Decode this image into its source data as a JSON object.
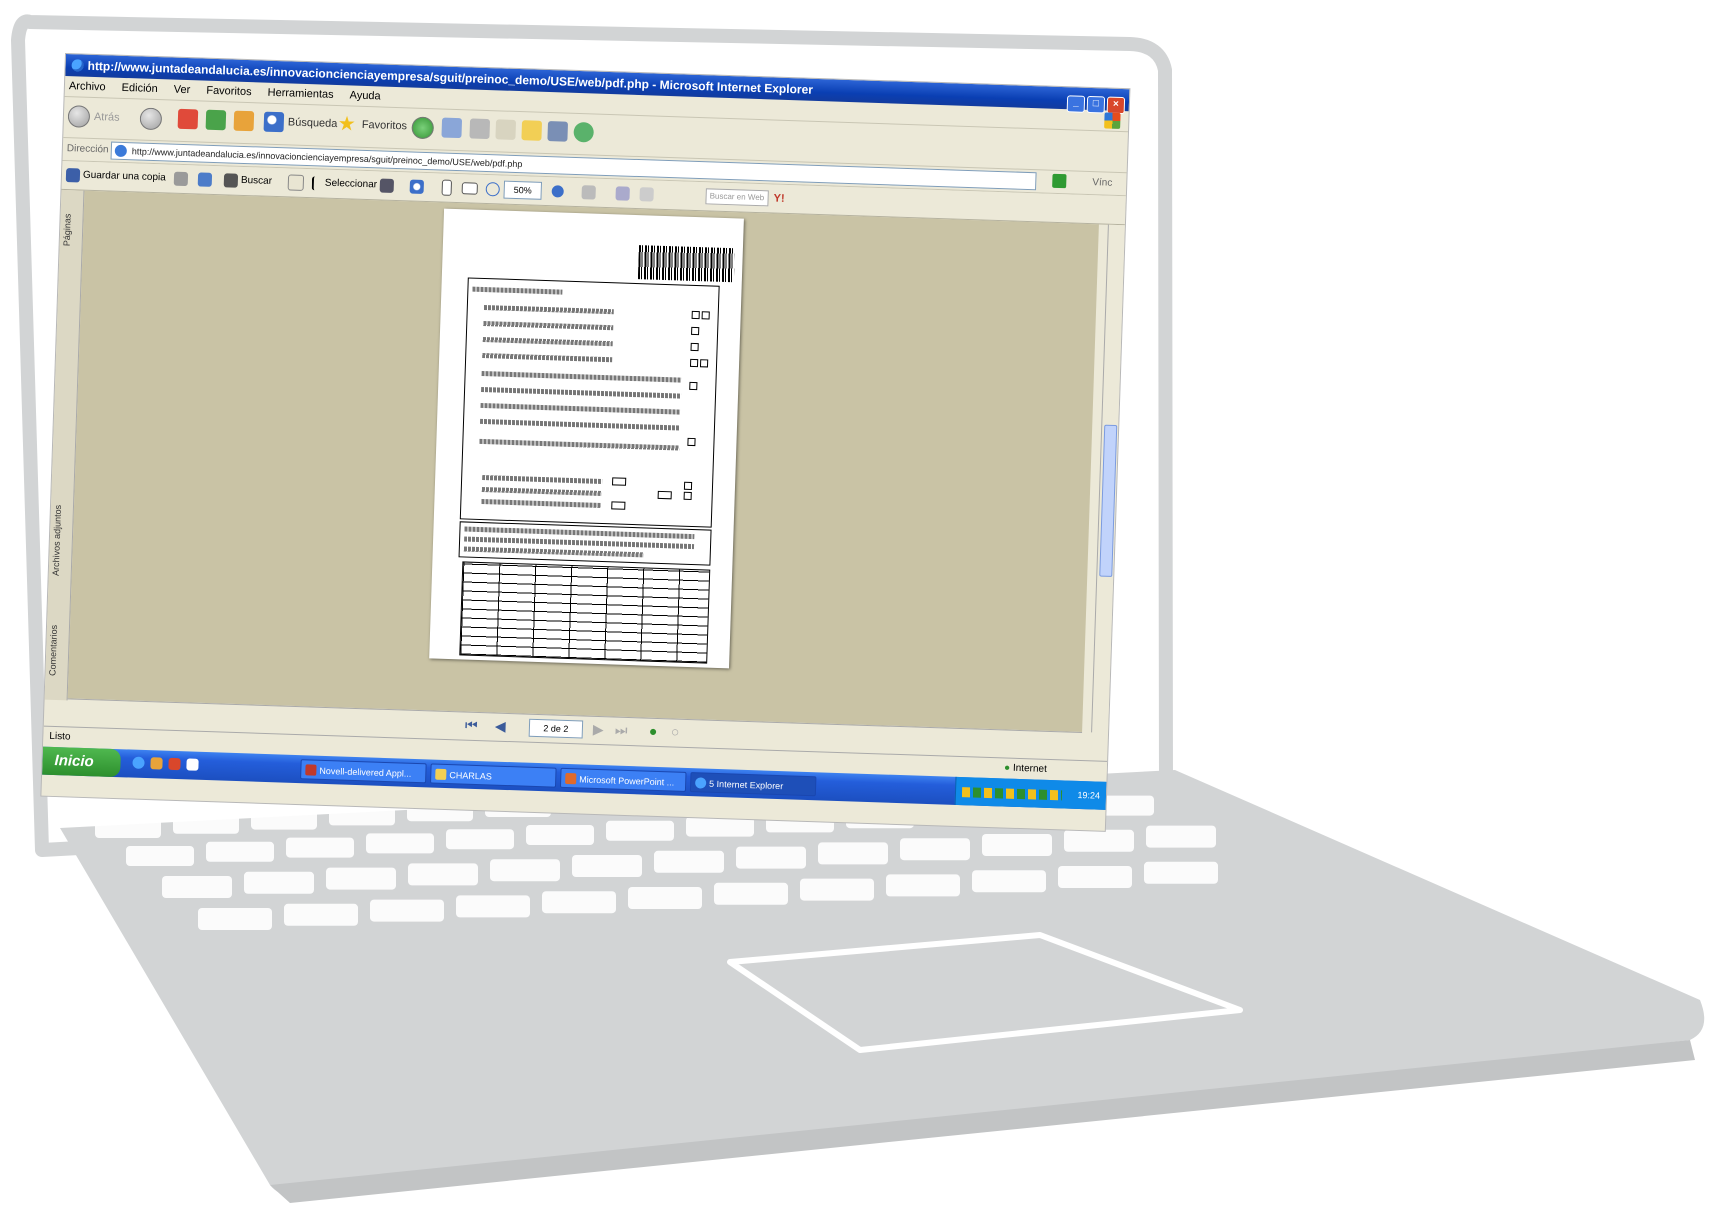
{
  "browser": {
    "title": "http://www.juntadeandalucia.es/innovacioncienciayempresa/sguit/preinoc_demo/USE/web/pdf.php - Microsoft Internet Explorer",
    "menu": [
      "Archivo",
      "Edición",
      "Ver",
      "Favoritos",
      "Herramientas",
      "Ayuda"
    ],
    "toolbar": {
      "back": "Atrás",
      "search": "Búsqueda",
      "favorites": "Favoritos"
    },
    "address_label": "Dirección",
    "address": "http://www.juntadeandalucia.es/innovacioncienciayempresa/sguit/preinoc_demo/USE/web/pdf.php",
    "links": "Vínc"
  },
  "pdf_toolbar": {
    "save": "Guardar una copia",
    "find": "Buscar",
    "select": "Seleccionar",
    "zoom": "50%",
    "search_web_placeholder": "Buscar en Web"
  },
  "side_tabs": [
    "Páginas",
    "Archivos adjuntos",
    "Comentarios"
  ],
  "pagination": {
    "page": "2 de 2"
  },
  "status": {
    "left": "Listo",
    "zone": "Internet"
  },
  "taskbar": {
    "start": "Inicio",
    "tasks": [
      "Novell-delivered Appl...",
      "CHARLAS",
      "Microsoft PowerPoint ...",
      "5 Internet Explorer"
    ],
    "time": "19:24"
  },
  "colors": {
    "laptop_body": "#d2d4d5",
    "xp_blue": "#245edb",
    "viewer_bg": "#c9c3a5"
  }
}
